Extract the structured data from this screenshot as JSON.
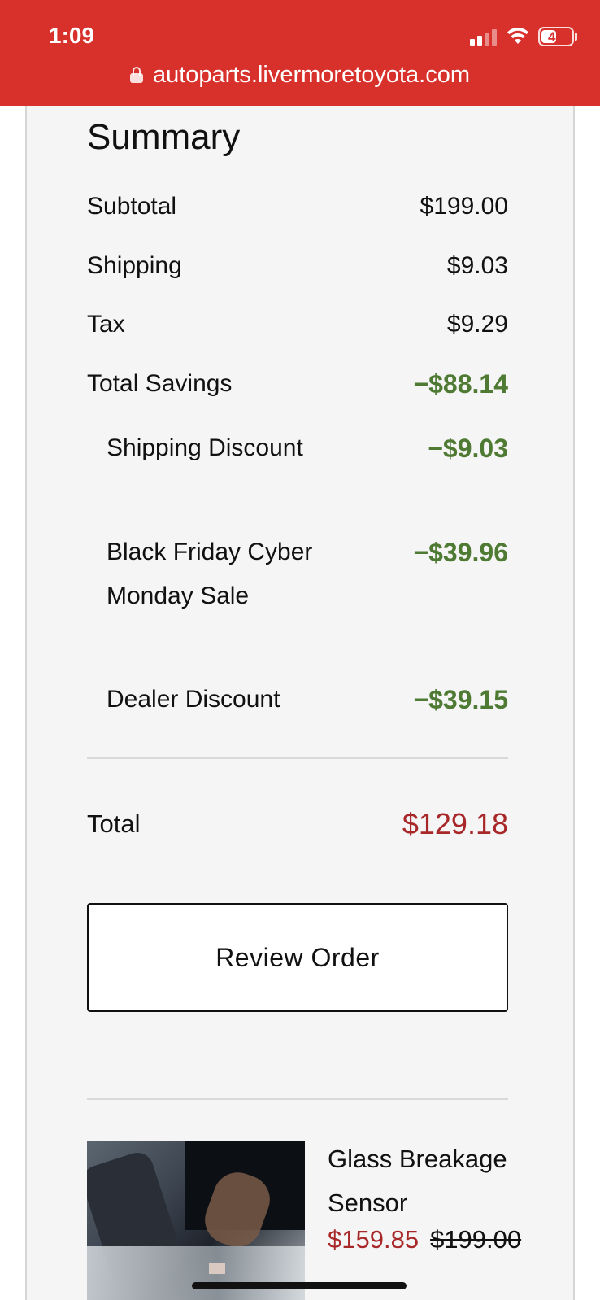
{
  "status_bar": {
    "time": "1:09",
    "battery": "43"
  },
  "browser": {
    "url": "autoparts.livermoretoyota.com"
  },
  "summary": {
    "title": "Summary",
    "subtotal": {
      "label": "Subtotal",
      "value": "$199.00"
    },
    "shipping": {
      "label": "Shipping",
      "value": "$9.03"
    },
    "tax": {
      "label": "Tax",
      "value": "$9.29"
    },
    "total_savings": {
      "label": "Total Savings",
      "value": "−$88.14"
    },
    "discounts": [
      {
        "label": "Shipping Discount",
        "value": "−$9.03"
      },
      {
        "label": "Black Friday Cyber Monday Sale",
        "value": "−$39.96"
      },
      {
        "label": "Dealer Discount",
        "value": "−$39.15"
      }
    ],
    "total": {
      "label": "Total",
      "value": "$129.18"
    },
    "review_button": "Review Order"
  },
  "product": {
    "name": "Glass Breakage Sensor",
    "sale_price": "$159.85",
    "original_price": "$199.00"
  },
  "colors": {
    "brand_red": "#d8312c",
    "savings_green": "#4f7a33",
    "total_red": "#a8282a"
  }
}
